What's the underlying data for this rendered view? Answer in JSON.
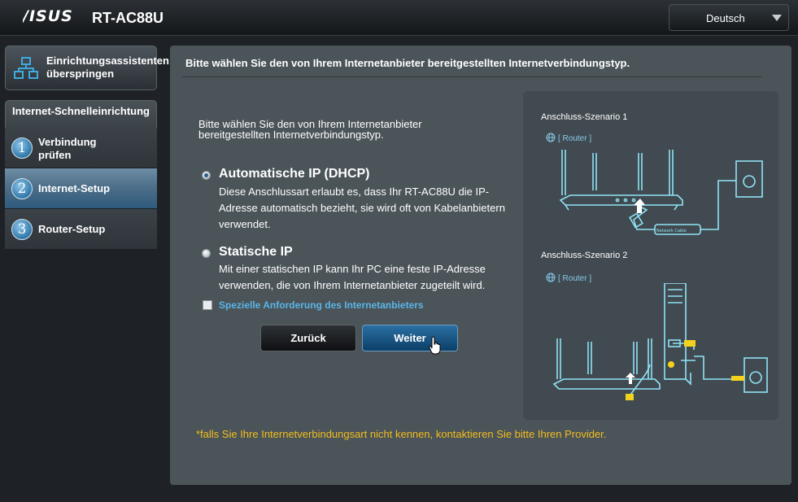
{
  "header": {
    "brand": "/ISUS",
    "model": "RT-AC88U",
    "language": "Deutsch"
  },
  "sidebar": {
    "skip_label": "Einrichtungsassistenten überspringen",
    "section_title": "Internet-Schnelleinrichtung",
    "steps": [
      {
        "number": "1",
        "label": "Verbindung prüfen",
        "active": false
      },
      {
        "number": "2",
        "label": "Internet-Setup",
        "active": true
      },
      {
        "number": "3",
        "label": "Router-Setup",
        "active": false
      }
    ]
  },
  "main": {
    "title": "Bitte wählen Sie den von Ihrem Internetanbieter bereitgestellten Internetverbindungstyp.",
    "intro": "Bitte wählen Sie den von Ihrem Internetanbieter bereitgestellten Internetverbindungstyp.",
    "options": [
      {
        "title": "Automatische IP (DHCP)",
        "description": "Diese Anschlussart erlaubt es, dass Ihr RT-AC88U die IP-Adresse automatisch bezieht, sie wird oft von Kabelanbietern verwendet.",
        "selected": true
      },
      {
        "title": "Statische IP",
        "description": "Mit einer statischen IP kann Ihr PC eine feste IP-Adresse verwenden, die von Ihrem Internetanbieter zugeteilt wird.",
        "selected": false
      }
    ],
    "special_request_label": "Spezielle Anforderung des Internetanbieters",
    "special_request_checked": false,
    "back_button": "Zurück",
    "next_button": "Weiter",
    "scenario1_label": "Anschluss-Szenario 1",
    "scenario2_label": "Anschluss-Szenario 2",
    "router_tag": "[ Router ]",
    "cable_label": "Network Cable",
    "footnote": "*falls Sie Ihre Internetverbindungsart nicht kennen, kontaktieren Sie bitte Ihren Provider."
  },
  "colors": {
    "panel_bg": "#4b5459",
    "link_blue": "#5ab6e8",
    "note_yellow": "#f2bd1d",
    "active_step": "#4e6f89"
  }
}
